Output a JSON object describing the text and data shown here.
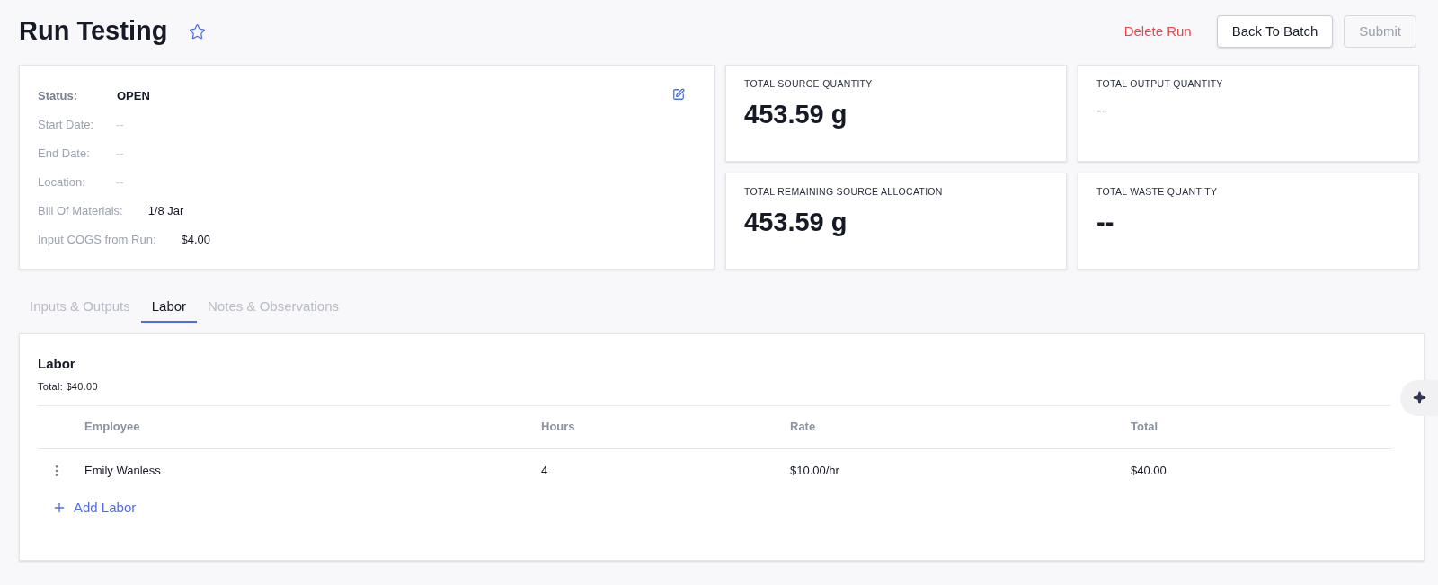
{
  "header": {
    "title": "Run Testing",
    "favorite": false,
    "actions": [
      {
        "label": "Delete Run",
        "kind": "danger",
        "disabled": false
      },
      {
        "label": "Back To Batch",
        "kind": "outline",
        "disabled": false
      },
      {
        "label": "Submit",
        "kind": "outline",
        "disabled": true
      }
    ]
  },
  "details": {
    "fields": [
      {
        "label": "Status:",
        "value": "OPEN",
        "kind": "status"
      },
      {
        "label": "Start Date:",
        "value": "--",
        "kind": "empty"
      },
      {
        "label": "End Date:",
        "value": "--",
        "kind": "empty"
      },
      {
        "label": "Location:",
        "value": "--",
        "kind": "empty"
      },
      {
        "label": "Bill Of Materials:",
        "value": "1/8 Jar",
        "kind": "value"
      },
      {
        "label": "Input COGS from Run:",
        "value": "$4.00",
        "kind": "value"
      }
    ]
  },
  "stats": [
    {
      "label": "TOTAL SOURCE QUANTITY",
      "value": "453.59 g",
      "kind": "big"
    },
    {
      "label": "TOTAL OUTPUT QUANTITY",
      "value": "--",
      "kind": "muted"
    },
    {
      "label": "TOTAL REMAINING SOURCE ALLOCATION",
      "value": "453.59 g",
      "kind": "big"
    },
    {
      "label": "TOTAL WASTE QUANTITY",
      "value": "--",
      "kind": "big"
    }
  ],
  "tabs": [
    {
      "label": "Inputs & Outputs",
      "selected": false
    },
    {
      "label": "Labor",
      "selected": true
    },
    {
      "label": "Notes & Observations",
      "selected": false
    }
  ],
  "labor": {
    "title": "Labor",
    "total": "Total: $40.00",
    "columns": [
      "Employee",
      "Hours",
      "Rate",
      "Total"
    ],
    "rows": [
      [
        "Emily Wanless",
        "4",
        "$10.00/hr",
        "$40.00"
      ]
    ],
    "add_button": "Add Labor"
  }
}
